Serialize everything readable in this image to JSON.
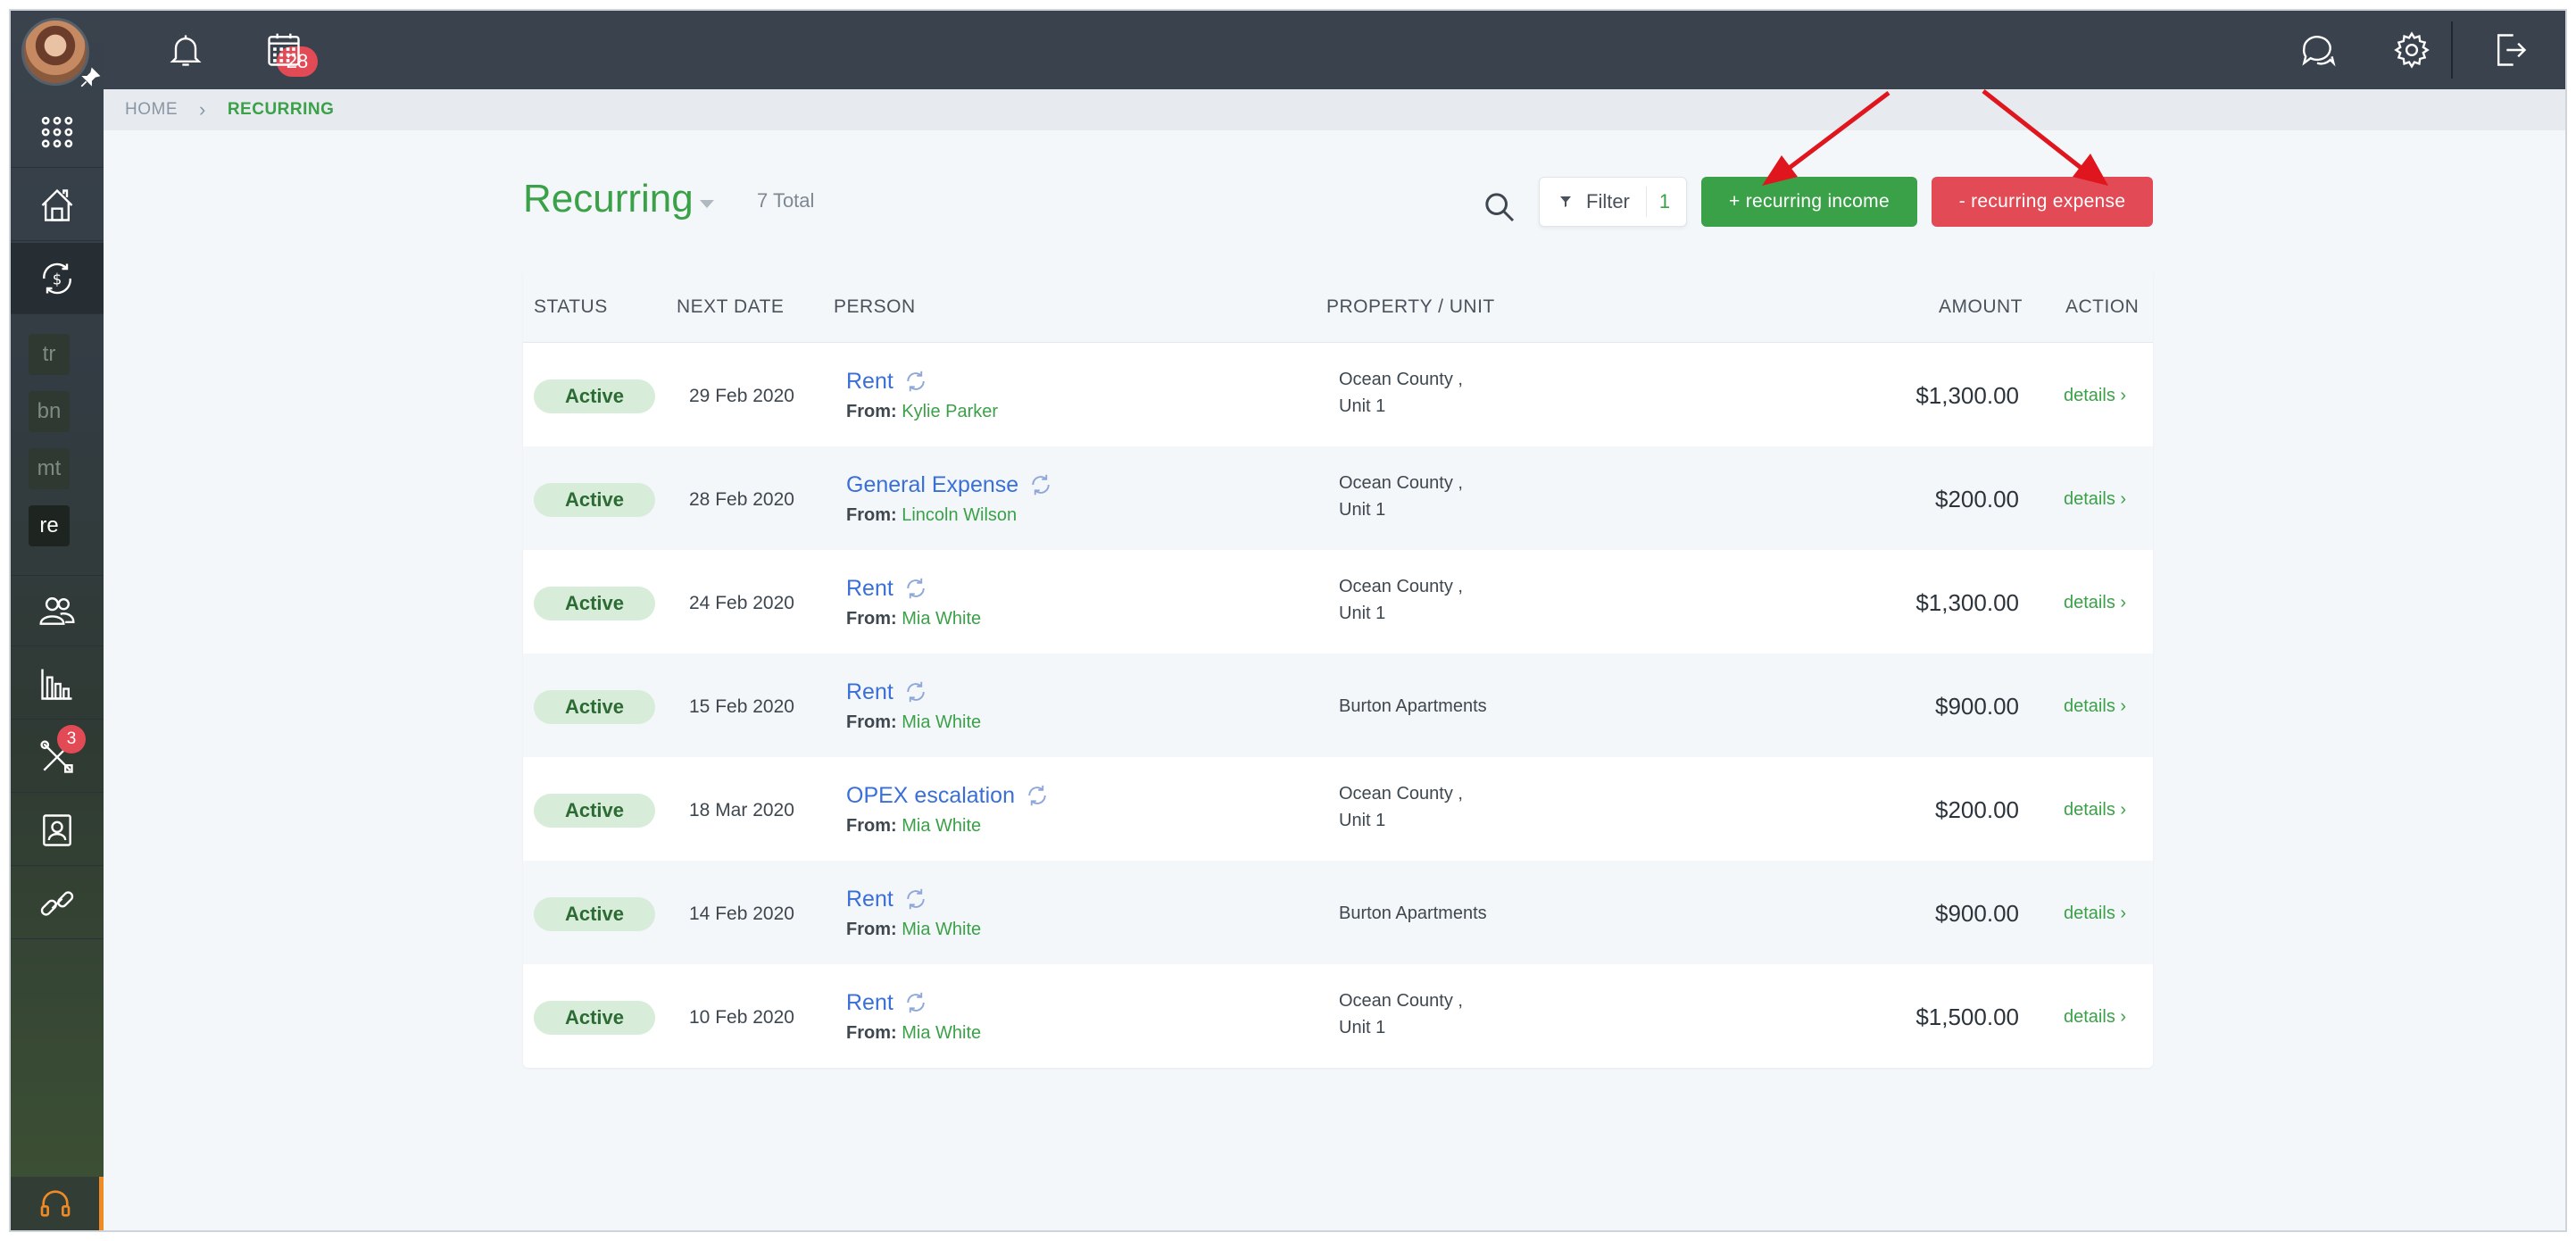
{
  "topbar": {
    "notifications_count": "28"
  },
  "sidebar": {
    "mini_items": [
      "tr",
      "bn",
      "mt",
      "re"
    ],
    "maintenance_badge": "3"
  },
  "breadcrumb": {
    "home": "HOME",
    "separator": "›",
    "current": "RECURRING"
  },
  "header": {
    "title": "Recurring",
    "total": "7 Total",
    "filter_label": "Filter",
    "filter_count": "1",
    "income_button": "+ recurring income",
    "expense_button": "- recurring expense"
  },
  "table": {
    "columns": {
      "status": "STATUS",
      "next_date": "NEXT DATE",
      "person": "PERSON",
      "property": "PROPERTY / UNIT",
      "amount": "AMOUNT",
      "action": "ACTION"
    },
    "rows": [
      {
        "status": "Active",
        "date": "29 Feb 2020",
        "title": "Rent",
        "from_label": "From:",
        "from": "Kylie Parker",
        "property": "Ocean County ,",
        "unit": "Unit 1",
        "amount": "$1,300.00",
        "action": "details ›"
      },
      {
        "status": "Active",
        "date": "28 Feb 2020",
        "title": "General Expense",
        "from_label": "From:",
        "from": "Lincoln Wilson",
        "property": "Ocean County ,",
        "unit": "Unit 1",
        "amount": "$200.00",
        "action": "details ›"
      },
      {
        "status": "Active",
        "date": "24 Feb 2020",
        "title": "Rent",
        "from_label": "From:",
        "from": "Mia White",
        "property": "Ocean County ,",
        "unit": "Unit 1",
        "amount": "$1,300.00",
        "action": "details ›"
      },
      {
        "status": "Active",
        "date": "15 Feb 2020",
        "title": "Rent",
        "from_label": "From:",
        "from": "Mia White",
        "property": "Burton Apartments",
        "unit": "",
        "amount": "$900.00",
        "action": "details ›"
      },
      {
        "status": "Active",
        "date": "18 Mar 2020",
        "title": "OPEX escalation",
        "from_label": "From:",
        "from": "Mia White",
        "property": "Ocean County ,",
        "unit": "Unit 1",
        "amount": "$200.00",
        "action": "details ›"
      },
      {
        "status": "Active",
        "date": "14 Feb 2020",
        "title": "Rent",
        "from_label": "From:",
        "from": "Mia White",
        "property": "Burton Apartments",
        "unit": "",
        "amount": "$900.00",
        "action": "details ›"
      },
      {
        "status": "Active",
        "date": "10 Feb 2020",
        "title": "Rent",
        "from_label": "From:",
        "from": "Mia White",
        "property": "Ocean County ,",
        "unit": "Unit 1",
        "amount": "$1,500.00",
        "action": "details ›"
      }
    ]
  },
  "colors": {
    "accent_green": "#3ba148",
    "accent_red": "#e24a55",
    "link_blue": "#3a6fd8",
    "topbar": "#3a434d",
    "annotation_arrow": "#e0161e"
  },
  "icons": {
    "sidebar": [
      "apps-grid-icon",
      "house-icon",
      "recurring-money-icon",
      "people-icon",
      "bar-chart-icon",
      "tools-icon",
      "contact-card-icon",
      "link-icon",
      "headset-icon"
    ],
    "topbar": [
      "bell-icon",
      "calendar-icon",
      "chat-icon",
      "gear-icon",
      "logout-icon"
    ]
  }
}
